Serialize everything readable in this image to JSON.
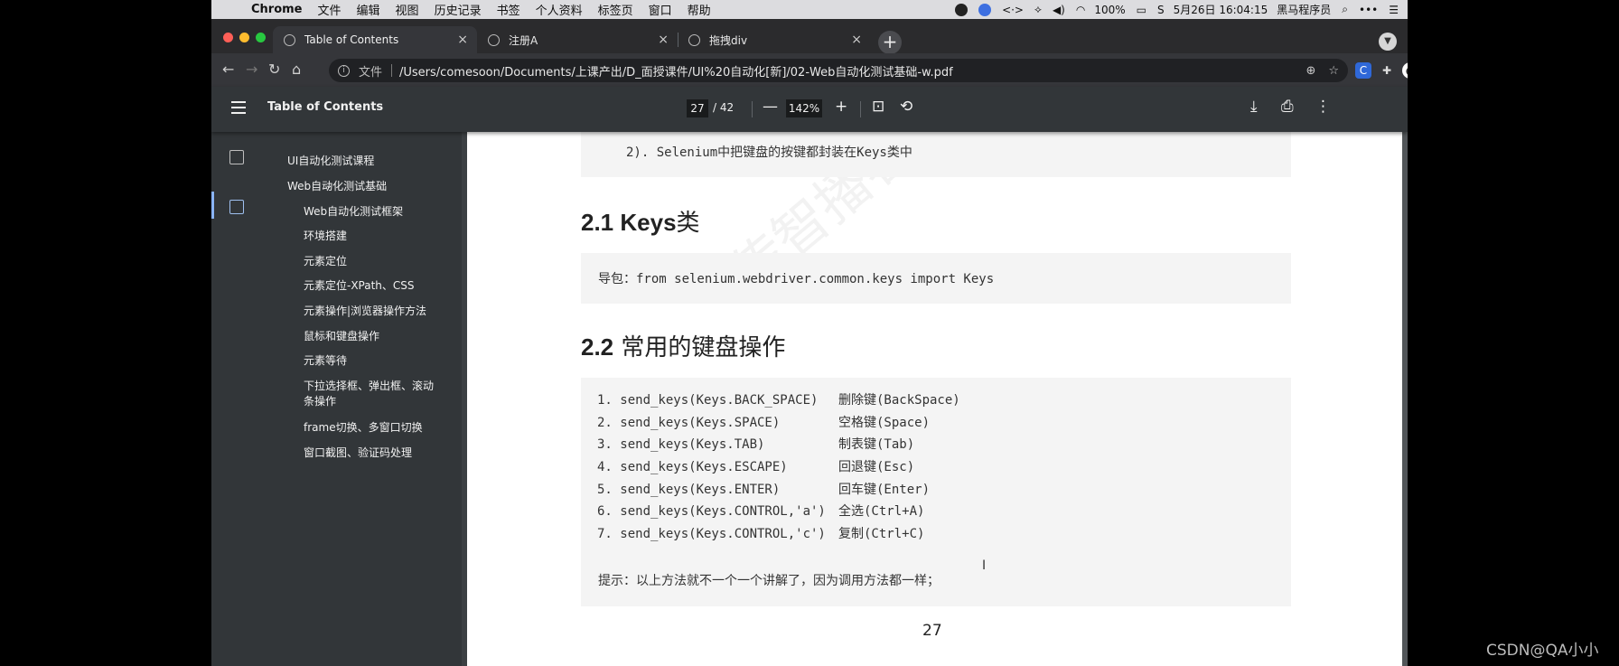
{
  "menubar": {
    "items": [
      "Chrome",
      "文件",
      "编辑",
      "视图",
      "历史记录",
      "书签",
      "个人资料",
      "标签页",
      "窗口",
      "帮助"
    ],
    "battery": "100%",
    "datetime": "5月26日 16:04:15",
    "user": "黑马程序员"
  },
  "tabs": [
    {
      "label": "Table of Contents"
    },
    {
      "label": "注册A"
    },
    {
      "label": "拖拽div"
    }
  ],
  "address": {
    "scheme_label": "文件",
    "url": "/Users/comesoon/Documents/上课产出/D_面授课件/UI%20自动化[新]/02-Web自动化测试基础-w.pdf"
  },
  "pdf": {
    "title": "Table of Contents",
    "page": "27",
    "total": "/ 42",
    "zoom": "142%"
  },
  "outline": [
    "UI自动化测试课程",
    "Web自动化测试基础",
    "Web自动化测试框架",
    "环境搭建",
    "元素定位",
    "元素定位-XPath、CSS",
    "元素操作|浏览器操作方法",
    "鼠标和键盘操作",
    "元素等待",
    "下拉选择框、弹出框、滚动",
    "条操作",
    "frame切换、多窗口切换",
    "窗口截图、验证码处理"
  ],
  "doc": {
    "prev_line": "2). Selenium中把键盘的按键都封装在Keys类中",
    "h1_num": "2.1 Keys",
    "h1_text": "类",
    "import_line": "导包：from selenium.webdriver.common.keys import Keys",
    "h2_num": "2.2",
    "h2_text": " 常用的键盘操作",
    "ops": [
      {
        "code": "1. send_keys(Keys.BACK_SPACE)",
        "desc": "删除键(BackSpace)"
      },
      {
        "code": "2. send_keys(Keys.SPACE)",
        "desc": "空格键(Space)"
      },
      {
        "code": "3. send_keys(Keys.TAB)",
        "desc": "制表键(Tab)"
      },
      {
        "code": "4. send_keys(Keys.ESCAPE)",
        "desc": "回退键(Esc)"
      },
      {
        "code": "5. send_keys(Keys.ENTER)",
        "desc": "回车键(Enter)"
      },
      {
        "code": "6. send_keys(Keys.CONTROL,'a')",
        "desc": "全选(Ctrl+A)"
      },
      {
        "code": "7. send_keys(Keys.CONTROL,'c')",
        "desc": "复制(Ctrl+C)"
      }
    ],
    "tip": "提示：以上方法就不一个一个讲解了，因为调用方法都一样；",
    "page_number": "27"
  },
  "watermark_text": "传智播客",
  "csdn": "CSDN@QA小小",
  "colors": {
    "close": "#ff5f57",
    "minimize": "#febc2e",
    "maximize": "#28c840",
    "accent": "#8ab4f8"
  }
}
